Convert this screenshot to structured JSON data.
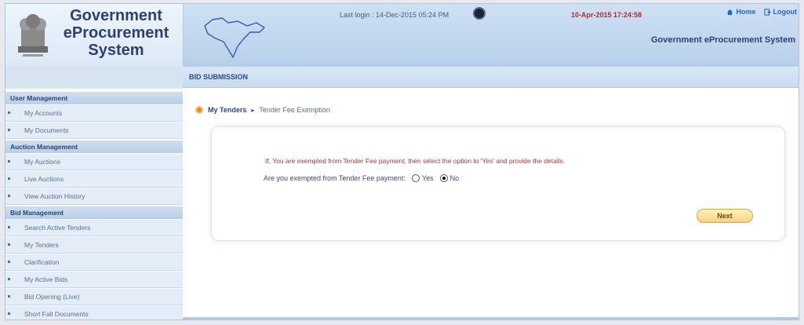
{
  "header": {
    "brand_line1": "Government",
    "brand_line2": "eProcurement",
    "brand_line3": "System",
    "last_login": "Last login : 14-Dec-2015 05:24 PM",
    "clock": "10-Apr-2015 17:24:58",
    "home_label": "Home",
    "logout_label": "Logout",
    "subtitle": "Government eProcurement System"
  },
  "sidebar": {
    "sections": [
      {
        "title": "User Management",
        "items": [
          "My Accounts",
          "My Documents"
        ]
      },
      {
        "title": "Auction Management",
        "items": [
          "My Auctions",
          "Live Auctions",
          "View Auction History"
        ]
      },
      {
        "title": "Bid Management",
        "items": [
          "Search Active Tenders",
          "My Tenders",
          "Clarification",
          "My Active Bids",
          "Bid Opening (Live)",
          "Short Fall Documents"
        ]
      }
    ]
  },
  "main": {
    "title": "BID SUBMISSION",
    "breadcrumb": {
      "parent": "My Tenders",
      "separator": "▸",
      "current": "Tender Fee Exemption"
    },
    "note": "If, You are exempted from Tender Fee payment, then select the option to 'Yes' and provide the details.",
    "question": "Are you exempted from Tender Fee payment:",
    "options": {
      "yes": "Yes",
      "no": "No",
      "selected": "No"
    },
    "next_label": "Next"
  },
  "colors": {
    "accent": "#2e3f78",
    "warning_text": "#c23030",
    "button": "#f6d07a"
  }
}
